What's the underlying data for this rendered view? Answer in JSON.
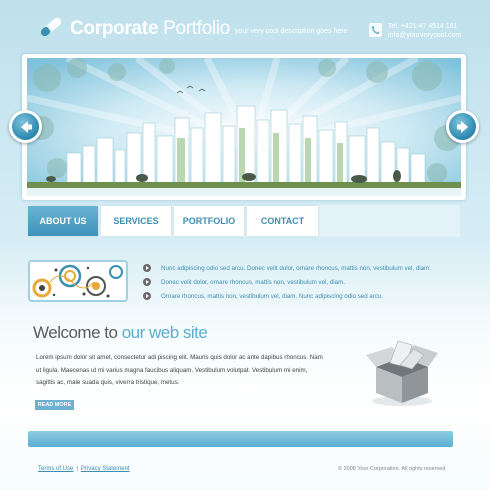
{
  "header": {
    "brand_bold": "Corporate",
    "brand_light": "Portfolio",
    "tagline": "your very cool description goes here",
    "phone": "Tel. +421 47 4514 161",
    "email": "info@yourverycool.com"
  },
  "banner": {
    "prev_icon": "arrow-left-icon",
    "next_icon": "arrow-right-icon"
  },
  "nav": {
    "items": [
      {
        "label": "ABOUT US",
        "active": true
      },
      {
        "label": "SERVICES",
        "active": false
      },
      {
        "label": "PORTFOLIO",
        "active": false
      },
      {
        "label": "CONTACT",
        "active": false
      }
    ]
  },
  "features": [
    "Nunc adipiscing odio sed arcu. Donec velit dolor, ornare rhoncus, mattis non, vestibulum vel, diam.",
    "Donec velit dolor, ornare rhoncus, mattis non, vestibulum vel, diam.",
    "Ornare rhoncus, mattis non, vestibulum vel, diam. Nunc adipiscing odio sed arcu."
  ],
  "welcome": {
    "title_dark": "Welcome to",
    "title_accent": "our web site",
    "lines": [
      "Lorem ipsum dolor sit amet, consectetur adi piscing elit. Mauris quis dolor ac ante dapibus rhoncus. Nam",
      "ut ligula. Maecenas ut mi varius magna faucibus aliquam. Vestibulum volutpat. Vestibulum mi enim,",
      "sagittis ac, male suada quis, viverra tristique, metus."
    ],
    "read_more": "READ MORE"
  },
  "footer": {
    "terms": "Terms of Use",
    "separator": "|",
    "privacy": "Privacy Statement",
    "copyright": "© 2008 Your Corporation. All rights reserved"
  },
  "colors": {
    "accent": "#3d8fb2",
    "accent_light": "#58aed0",
    "background_top": "#bfe0ec"
  }
}
